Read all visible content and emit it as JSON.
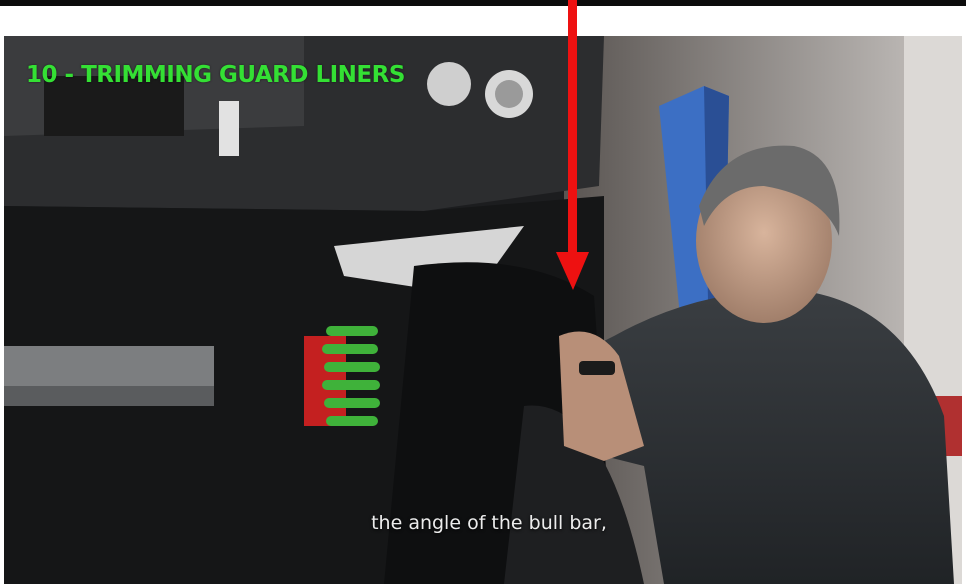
{
  "video": {
    "title_overlay": "10 - TRIMMING GUARD LINERS",
    "caption": "the angle of the bull bar,"
  },
  "annotation": {
    "arrow_color": "#ee1111",
    "title_color": "#34e034"
  }
}
